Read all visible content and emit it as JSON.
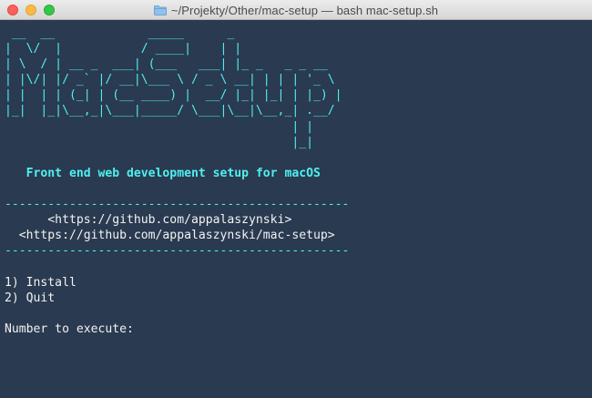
{
  "window": {
    "title": "~/Projekty/Other/mac-setup — bash mac-setup.sh",
    "icon": "folder-icon"
  },
  "terminal": {
    "banner": [
      " __  __             _____      _",
      "|  \\/  |           / ____|    | |",
      "| \\  / | __ _  ___| (___   ___| |_ _   _ _ __",
      "| |\\/| |/ _` |/ __|\\___ \\ / _ \\ __| | | | '_ \\",
      "| |  | | (_| | (__ ____) |  __/ |_| |_| | |_) |",
      "|_|  |_|\\__,_|\\___|_____/ \\___|\\__|\\__,_| .__/",
      "                                        | |",
      "                                        |_|"
    ],
    "subtitle": "   Front end web development setup for macOS",
    "rule_top": "------------------------------------------------",
    "links": [
      "      <https://github.com/appalaszynski>",
      "  <https://github.com/appalaszynski/mac-setup>"
    ],
    "rule_bottom": "------------------------------------------------",
    "menu": [
      "1) Install",
      "2) Quit"
    ],
    "prompt": "Number to execute:"
  },
  "colors": {
    "background": "#2a3a50",
    "accent": "#4ff0f0",
    "text": "#f2f2f2"
  }
}
